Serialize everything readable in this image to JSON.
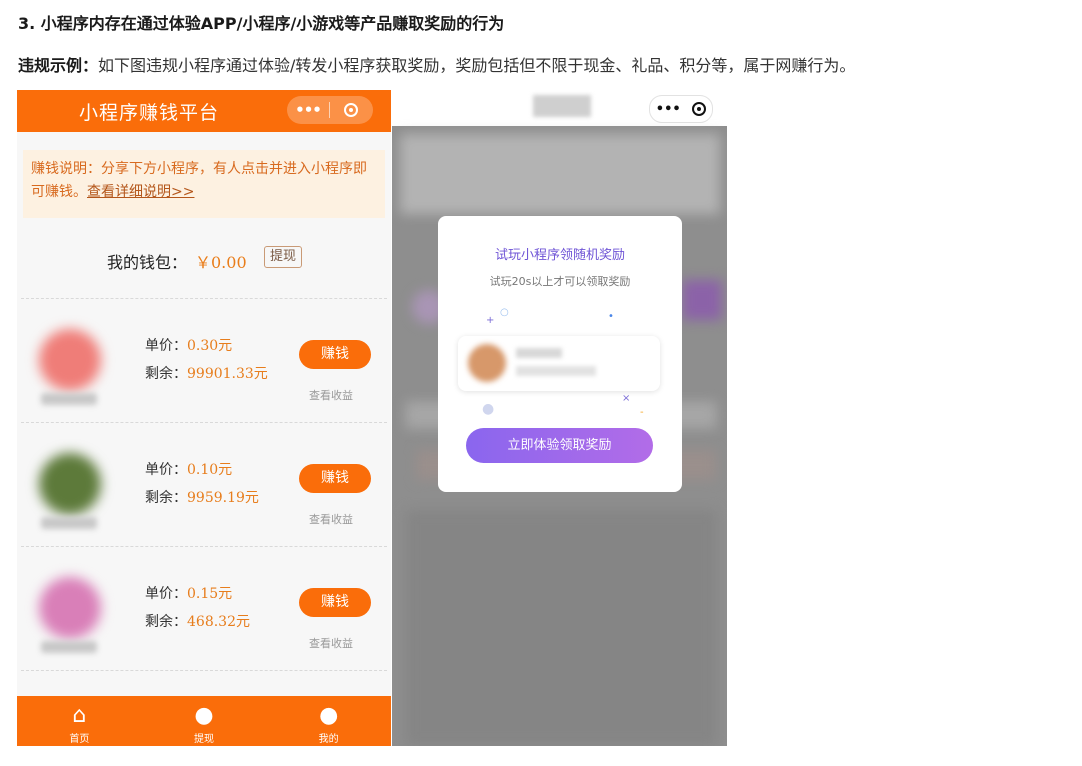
{
  "heading": "3. 小程序内存在通过体验APP/小程序/小游戏等产品赚取奖励的行为",
  "example": {
    "label": "违规示例：",
    "text": "如下图违规小程序通过体验/转发小程序获取奖励，奖励包括但不限于现金、礼品、积分等，属于网赚行为。"
  },
  "left_phone": {
    "title": "小程序赚钱平台",
    "capsule_more": "•••",
    "notice_text": "赚钱说明：分享下方小程序，有人点击并进入小程序即可赚钱。",
    "notice_link": "查看详细说明>>",
    "wallet_label": "我的钱包：",
    "wallet_amount": "￥0.00",
    "withdraw_btn": "提现",
    "price_label": "单价：",
    "remain_label": "剩余：",
    "earn_label": "赚钱",
    "income_label": "查看收益",
    "items": [
      {
        "price": "0.30元",
        "remain": "99901.33元",
        "avatar_color": "#ef7d78"
      },
      {
        "price": "0.10元",
        "remain": "9959.19元",
        "avatar_color": "#5d7a3a"
      },
      {
        "price": "0.15元",
        "remain": "468.32元",
        "avatar_color": "#d97fb8"
      }
    ],
    "tabs": [
      {
        "label": "首页",
        "icon": "home-icon"
      },
      {
        "label": "提现",
        "icon": "money-bag-icon"
      },
      {
        "label": "我的",
        "icon": "user-icon"
      }
    ]
  },
  "right_phone": {
    "capsule_more": "•••",
    "modal_title": "试玩小程序领随机奖励",
    "modal_subtitle": "试玩20s以上才可以领取奖励",
    "cta": "立即体验领取奖励"
  },
  "colors": {
    "orange": "#fa6d0a",
    "purple": "#8a66ee"
  }
}
